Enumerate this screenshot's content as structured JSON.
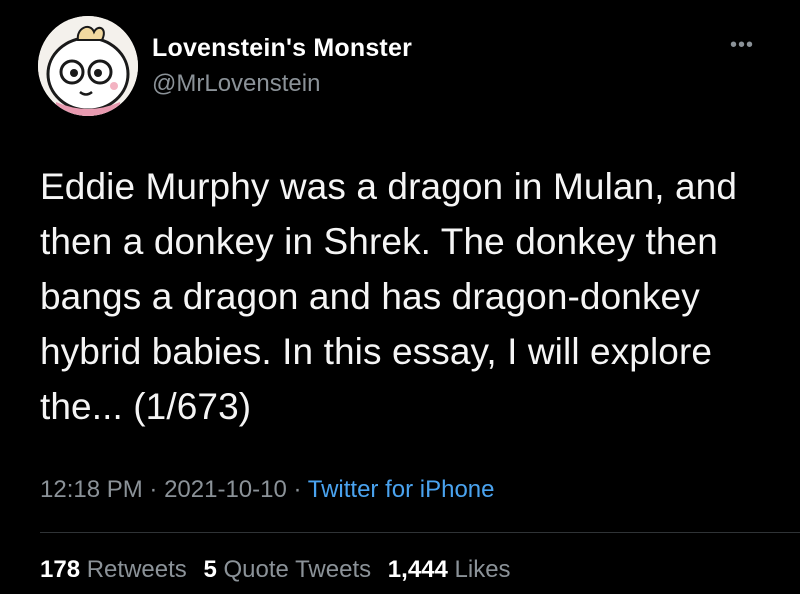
{
  "author": {
    "display_name": "Lovenstein's Monster",
    "handle": "@MrLovenstein",
    "avatar_icon": "cartoon-character-avatar"
  },
  "more_icon": "more-options-icon",
  "tweet": {
    "text": "Eddie Murphy was a dragon in Mulan, and then a donkey in Shrek. The donkey then bangs a dragon and has dragon-donkey hybrid babies. In this essay, I will explore the... (1/673)"
  },
  "meta": {
    "time": "12:18 PM",
    "separator": " · ",
    "date": "2021-10-10",
    "source": "Twitter for iPhone"
  },
  "stats": {
    "retweets_count": "178",
    "retweets_label": "Retweets",
    "quotes_count": "5",
    "quotes_label": "Quote Tweets",
    "likes_count": "1,444",
    "likes_label": "Likes"
  },
  "colors": {
    "background": "#000000",
    "link": "#4aa3ef",
    "muted": "#8b9298",
    "divider": "#2f3336"
  }
}
